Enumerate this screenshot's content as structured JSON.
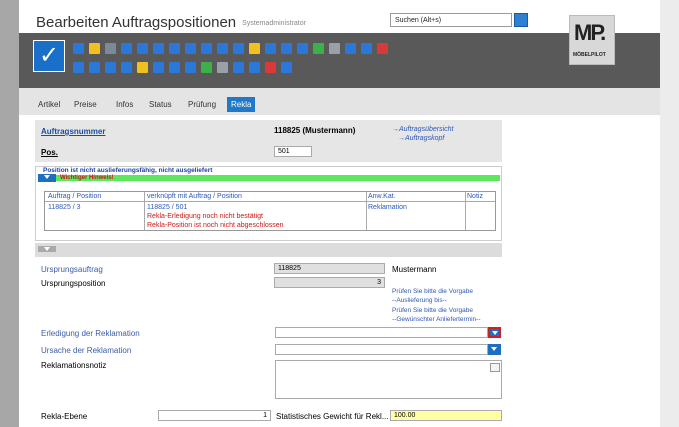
{
  "header": {
    "title": "Bearbeiten Auftragspositionen",
    "user": "Systemadministrator",
    "search_placeholder": "Suchen (Alt+s)",
    "logo_text": "MP.",
    "logo_subtext": "MÖBELPILOT"
  },
  "toolbar": {
    "check_glyph": "✓",
    "row1_icons": [
      "doc-new-icon",
      "doc-yellow-icon",
      "trash-icon",
      "help-icon",
      "back-arrow-icon",
      "search-icon",
      "print-icon",
      "first-icon",
      "prev-icon",
      "next-icon",
      "last-icon",
      "group-icon",
      "user-icon",
      "settings-icon",
      "cart-icon",
      "doc-green-icon",
      "doc-gray-icon",
      "doc-multi-icon",
      "doc-blue-icon",
      "doc-red-icon"
    ],
    "row2_icons": [
      "truck-icon",
      "red-doc-icon",
      "truck2-icon",
      "pen-icon",
      "doc-check-icon",
      "doc-check2-icon",
      "doc-person-icon",
      "doc-search-icon",
      "flag-icon",
      "globe-icon",
      "printer-icon",
      "v-icon",
      "doc-lines-icon",
      "table-icon"
    ],
    "colors": [
      "#2b78d8",
      "#f0c020",
      "#7a8a9a",
      "#2b78d8",
      "#2b78d8",
      "#2b78d8",
      "#2b78d8",
      "#2b78d8",
      "#2b78d8",
      "#2b78d8",
      "#2b78d8",
      "#f0c020",
      "#2b78d8",
      "#2b78d8",
      "#2b78d8",
      "#3cb04a",
      "#9aa0a8",
      "#2b78d8",
      "#2b78d8",
      "#d83a3a"
    ]
  },
  "tabs": [
    {
      "label": "Artikel"
    },
    {
      "label": "Preise"
    },
    {
      "label": "Infos"
    },
    {
      "label": "Status"
    },
    {
      "label": "Prüfung"
    },
    {
      "label": "Rekla"
    }
  ],
  "order": {
    "auftragsnummer_label": "Auftragsnummer",
    "auftragsnummer_value": "118825 (Mustermann)",
    "pos_label": "Pos.",
    "pos_value": "501",
    "link_overview": "→Auftragsübersicht",
    "link_head": "→Auftragskopf"
  },
  "warning": {
    "status_text": "Position ist nicht auslieferungsfähig, nicht ausgeliefert",
    "hint_label": "Wichtiger Hinweis!",
    "columns": [
      "Auftrag / Position",
      "verknüpft mit Auftrag / Position",
      "Anw.Kat.",
      "Notiz"
    ],
    "row": {
      "auftrag": "118825 / 3",
      "verknuepft": "118825 / 501",
      "kat": "Reklamation",
      "msg1": "Rekla-Erledigung noch nicht bestätigt",
      "msg2": "Rekla-Position ist noch nicht abgeschlossen"
    }
  },
  "form": {
    "ursprungsauftrag_label": "Ursprungsauftrag",
    "ursprungsauftrag_value": "118825",
    "ursprungsauftrag_name": "Mustermann",
    "ursprungsposition_label": "Ursprungsposition",
    "ursprungsposition_value": "3",
    "pruefen1": "Prüfen Sie bitte die Vorgabe",
    "auslieferung": "--Auslieferung bis--",
    "pruefen2": "Prüfen Sie bitte die Vorgabe",
    "anliefertermin": "--Gewünschter Anliefertermin--",
    "erledigung_label": "Erledigung der Reklamation",
    "ursache_label": "Ursache der Reklamation",
    "notiz_label": "Reklamationsnotiz",
    "ebene_label": "Rekla-Ebene",
    "ebene_value": "1",
    "gewicht_label": "Statistisches Gewicht für Rekl...",
    "gewicht_value": "100.00"
  }
}
